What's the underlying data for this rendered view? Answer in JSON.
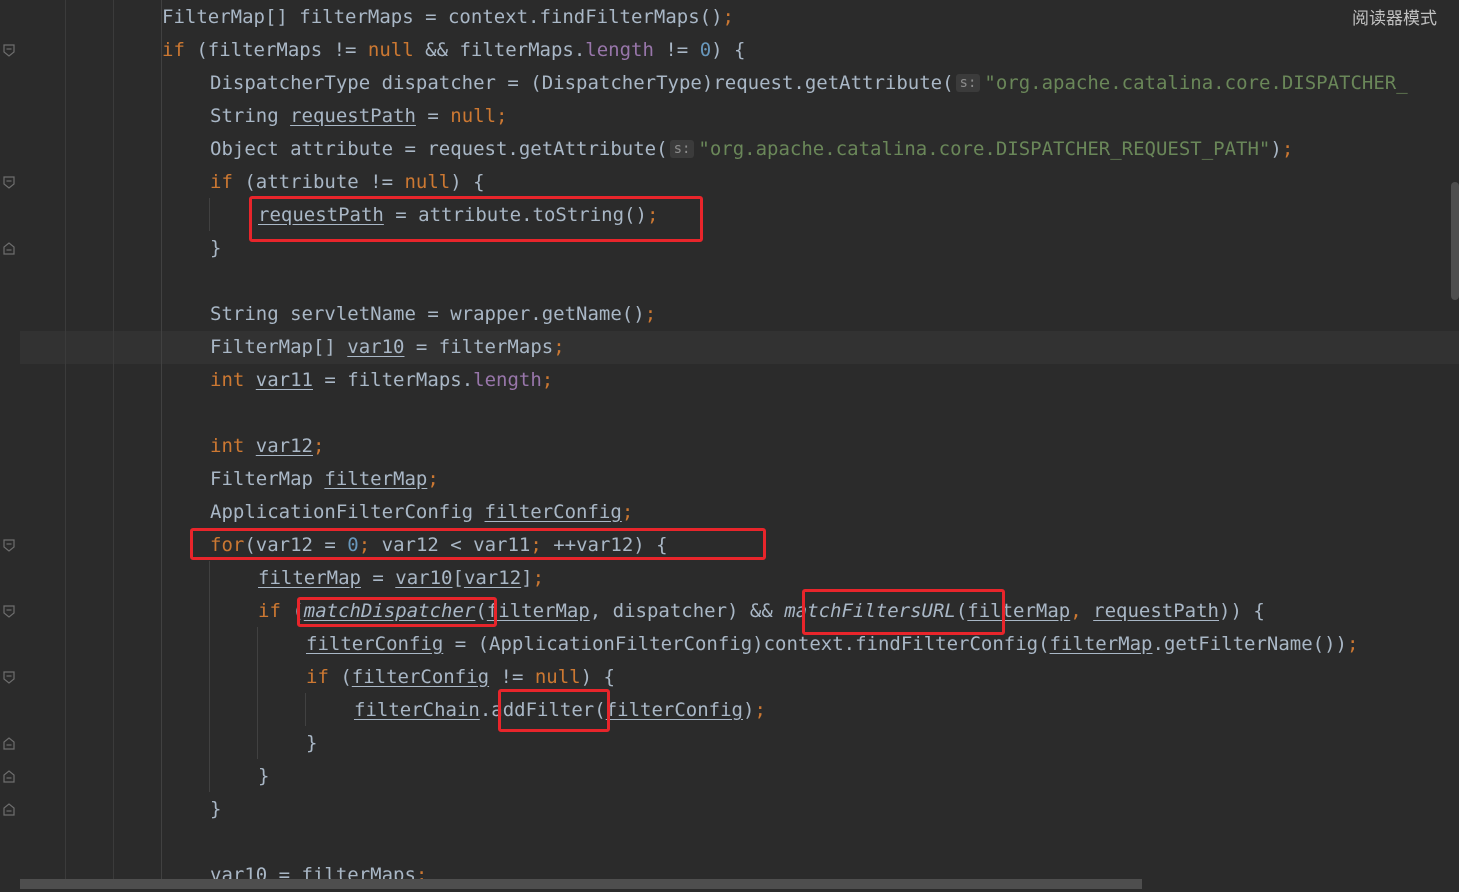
{
  "reader_mode": "阅读器模式",
  "hint_s": "s:",
  "code": {
    "l1": {
      "a": "FilterMap[] filterMaps = context.findFilterMaps()",
      "semi": ";"
    },
    "l2": {
      "if": "if",
      "a": " (filterMaps != ",
      "null": "null",
      "b": " && filterMaps.",
      "length": "length",
      "c": " != ",
      "zero": "0",
      "d": ") {"
    },
    "l3": {
      "a": "DispatcherType dispatcher = (DispatcherType)request.getAttribute(",
      "str": "\"org.apache.catalina.core.DISPATCHER_"
    },
    "l4": {
      "a": "String ",
      "var": "requestPath",
      "b": " = ",
      "null": "null",
      "semi": ";"
    },
    "l5": {
      "a": "Object attribute = request.getAttribute(",
      "str": "\"org.apache.catalina.core.DISPATCHER_REQUEST_PATH\"",
      "b": ")",
      "semi": ";"
    },
    "l6": {
      "if": "if",
      "a": " (attribute != ",
      "null": "null",
      "b": ") {"
    },
    "l7": {
      "var": "requestPath",
      "a": " = attribute.toString()",
      "semi": ";"
    },
    "l8": {
      "a": "}"
    },
    "l9": {
      "a": "String servletName = wrapper.getName()",
      "semi": ";"
    },
    "l10": {
      "a": "FilterMap[] ",
      "var": "var10",
      "b": " = filterMaps",
      "semi": ";"
    },
    "l11": {
      "int": "int",
      "sp": " ",
      "var": "var11",
      "a": " = filterMaps.",
      "length": "length",
      "semi": ";"
    },
    "l12": {
      "int": "int",
      "sp": " ",
      "var": "var12",
      "semi": ";"
    },
    "l13": {
      "a": "FilterMap ",
      "var": "filterMap",
      "semi": ";"
    },
    "l14": {
      "a": "ApplicationFilterConfig ",
      "var": "filterConfig",
      "semi": ";"
    },
    "l15": {
      "for": "for",
      "a": "(var12 = ",
      "zero": "0",
      "s1": ";",
      "b": " var12 < var11",
      "s2": ";",
      "c": " ++var12) {"
    },
    "l16": {
      "v1": "filterMap",
      "a": " = ",
      "v2": "var10",
      "b": "[",
      "v3": "var12",
      "c": "]",
      "semi": ";"
    },
    "l17": {
      "if": "if",
      "a": " (",
      "m1": "matchDispatcher",
      "b": "(",
      "v1": "filterMap",
      "c": ", dispatcher) && ",
      "m2": "matchFiltersURL",
      "d": "(",
      "v2": "filterMap",
      "comma": ",",
      "e": " ",
      "v3": "requestPath",
      "f": ")) {"
    },
    "l18": {
      "v1": "filterConfig",
      "a": " = (ApplicationFilterConfig)context.findFilterConfig(",
      "v2": "filterMap",
      "b": ".getFilterName())",
      "semi": ";"
    },
    "l19": {
      "if": "if",
      "a": " (",
      "v1": "filterConfig",
      "b": " != ",
      "null": "null",
      "c": ") {"
    },
    "l20": {
      "v1": "filterChain",
      "a": ".",
      "m": "addFilter",
      "b": "(",
      "v2": "filterConfig",
      "c": ")",
      "semi": ";"
    },
    "l21": {
      "a": "}"
    },
    "l22": {
      "a": "}"
    },
    "l23": {
      "a": "}"
    },
    "l24": {
      "var": "var10",
      "a": " = filterMaps",
      "semi": ";"
    }
  }
}
